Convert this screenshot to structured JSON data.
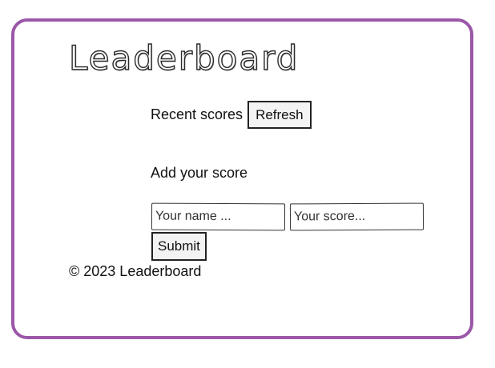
{
  "page": {
    "title": "Leaderboard",
    "border_color": "#9b57a8"
  },
  "recent": {
    "label": "Recent scores",
    "refresh_label": "Refresh"
  },
  "add_score": {
    "heading": "Add your score",
    "name_placeholder": "Your name ...",
    "score_placeholder": "Your score...",
    "submit_label": "Submit"
  },
  "footer": {
    "text": "© 2023 Leaderboard"
  }
}
